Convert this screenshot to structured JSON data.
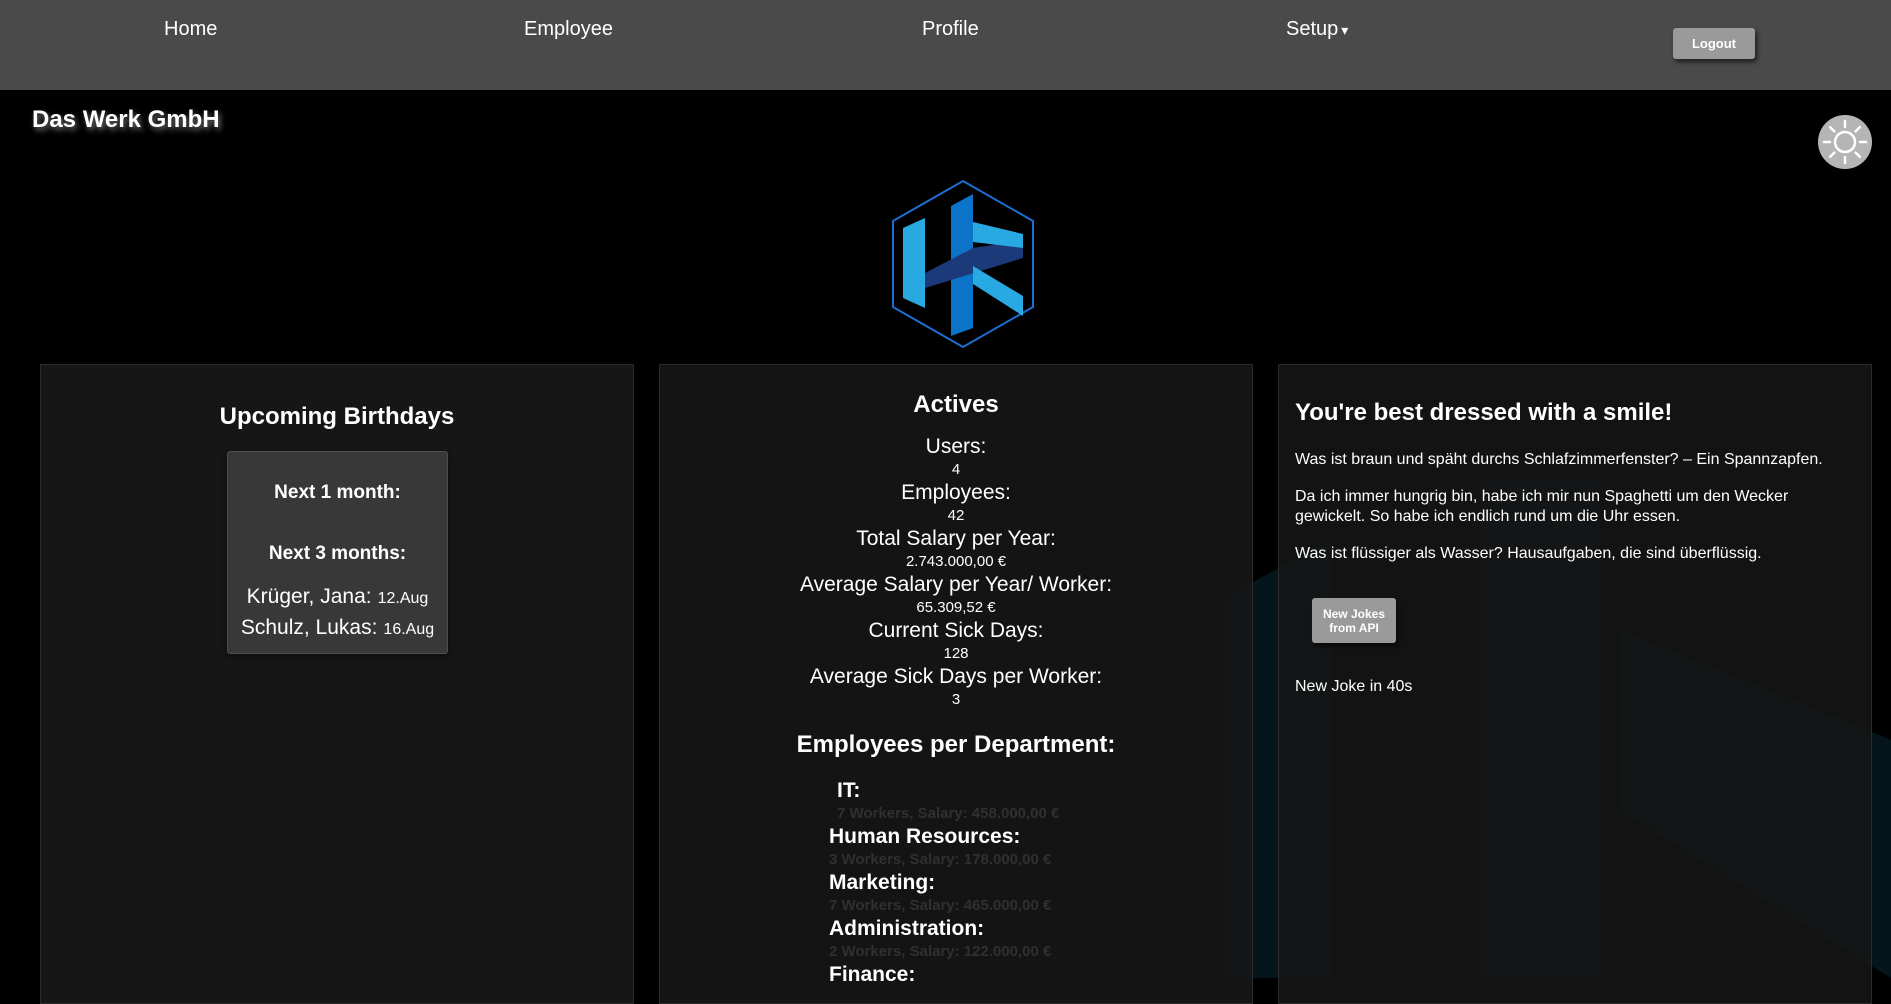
{
  "nav": {
    "home": "Home",
    "employee": "Employee",
    "profile": "Profile",
    "setup": "Setup",
    "setup_caret": "▾",
    "logout": "Logout"
  },
  "company": "Das Werk GmbH",
  "brand_colors": {
    "logo_light": "#29a9e1",
    "logo_dark": "#0b74c8",
    "logo_outline": "#1a6fd0"
  },
  "birthdays": {
    "title": "Upcoming Birthdays",
    "next_1_month": "Next 1 month:",
    "next_3_months": "Next 3 months:",
    "entries": [
      {
        "name": "Krüger, Jana:",
        "date": "12.Aug"
      },
      {
        "name": "Schulz, Lukas:",
        "date": "16.Aug"
      }
    ]
  },
  "actives": {
    "title": "Actives",
    "stats": [
      {
        "label": "Users:",
        "value": "4"
      },
      {
        "label": "Employees:",
        "value": "42"
      },
      {
        "label": "Total Salary per Year:",
        "value": "2.743.000,00 €"
      },
      {
        "label": "Average Salary per Year/ Worker:",
        "value": "65.309,52 €"
      },
      {
        "label": "Current Sick Days:",
        "value": "128"
      },
      {
        "label": "Average Sick Days per Worker:",
        "value": "3"
      }
    ],
    "departments_title": "Employees per Department:",
    "departments": [
      {
        "name": "IT:",
        "detail": "7 Workers, Salary: 458.000,00 €"
      },
      {
        "name": "Human Resources:",
        "detail": "3 Workers, Salary: 178.000,00 €"
      },
      {
        "name": "Marketing:",
        "detail": "7 Workers, Salary: 465.000,00 €"
      },
      {
        "name": "Administration:",
        "detail": "2 Workers, Salary: 122.000,00 €"
      },
      {
        "name": "Finance:",
        "detail": ""
      }
    ]
  },
  "jokes": {
    "heading": "You're best dressed with a smile!",
    "items": [
      "Was ist braun und späht durchs Schlafzimmerfenster? – Ein Spannzapfen.",
      "Da ich immer hungrig bin, habe ich mir nun Spaghetti um den Wecker gewickelt. So habe ich endlich rund um die Uhr essen.",
      "Was ist flüssiger als Wasser? Hausaufgaben, die sind überflüssig."
    ],
    "button_line1": "New Jokes",
    "button_line2": "from API",
    "timer": "New Joke in 40s"
  }
}
